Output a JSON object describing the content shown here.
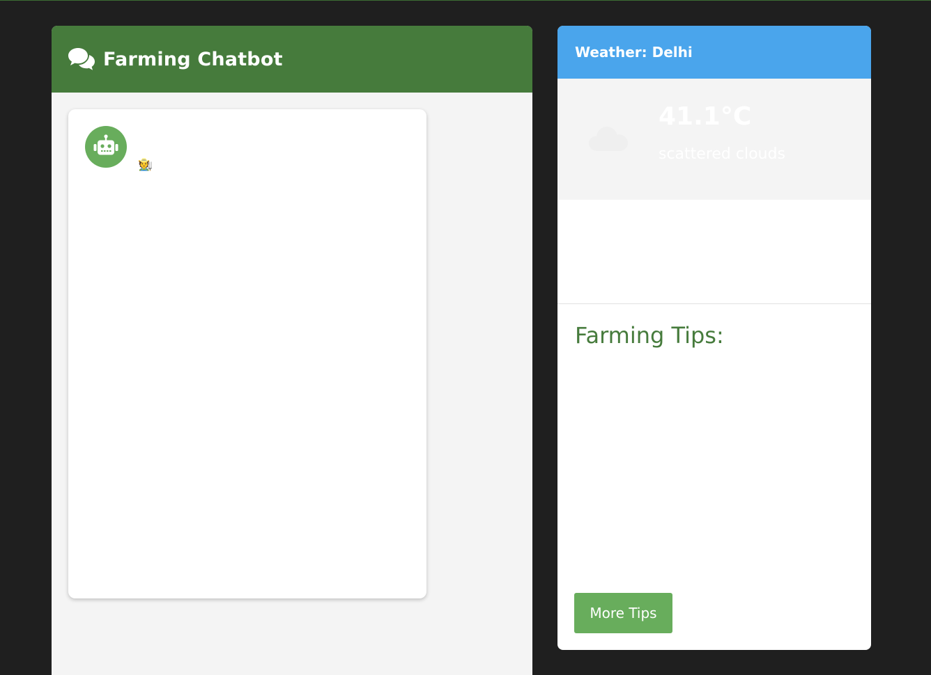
{
  "chat": {
    "title": "Farming Chatbot",
    "header_icon": "comments-icon",
    "bot_avatar_icon": "robot-icon",
    "bot_message": "🧑‍🌾"
  },
  "weather": {
    "title": "Weather: Delhi",
    "temperature": "41.1°C",
    "condition": "scattered clouds",
    "condition_icon": "cloud-icon"
  },
  "tips": {
    "heading": "Farming Tips:",
    "button_label": "More Tips"
  },
  "colors": {
    "chat_header": "#467b3c",
    "weather_header": "#4aa5ec",
    "button": "#68ad5c",
    "background": "#1f1f1f"
  }
}
